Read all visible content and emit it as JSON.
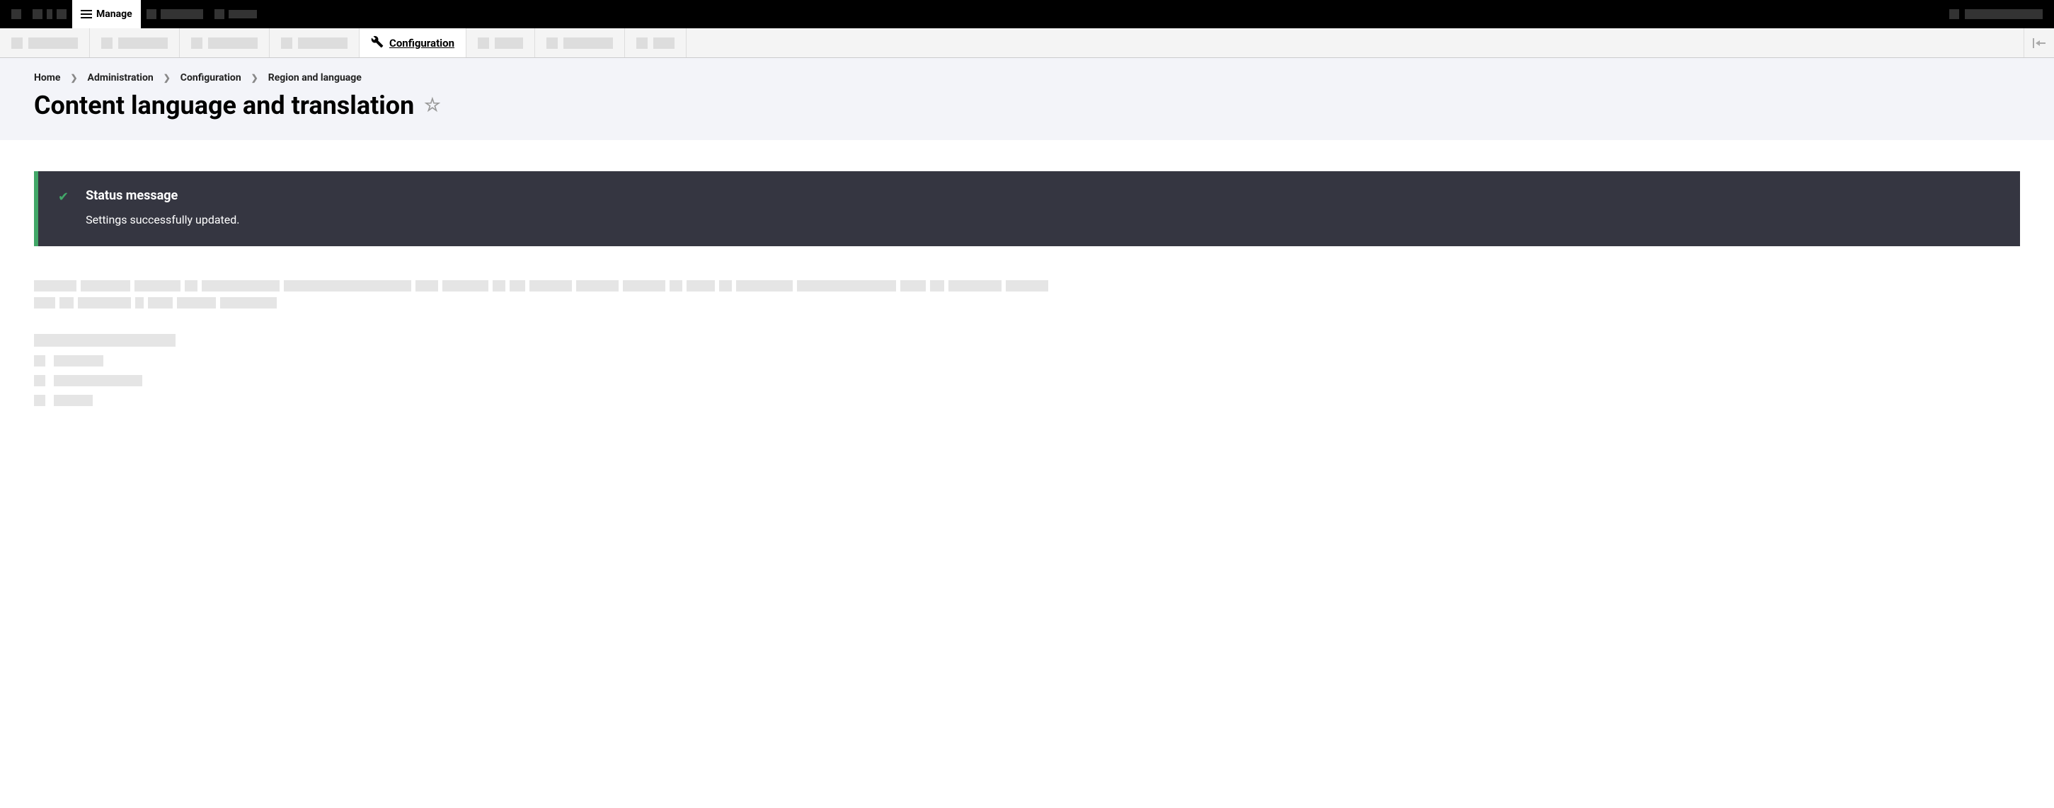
{
  "top_bar": {
    "manage_label": "Manage"
  },
  "secondary_bar": {
    "configuration_label": "Configuration"
  },
  "breadcrumb": {
    "items": [
      "Home",
      "Administration",
      "Configuration",
      "Region and language"
    ]
  },
  "page_title": "Content language and translation",
  "status": {
    "heading": "Status message",
    "text": "Settings successfully updated."
  }
}
